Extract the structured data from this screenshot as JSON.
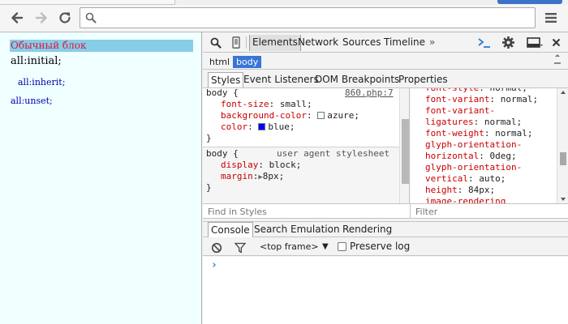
{
  "browser": {
    "address_value": "",
    "menu_icon": "hamburger-menu-icon"
  },
  "page": {
    "normal_block": "Обычный блок",
    "all_initial": "all:initial;",
    "all_inherit": "all:inherit;",
    "all_unset": "all:unset;"
  },
  "devtools": {
    "tabs": [
      "Elements",
      "Network",
      "Sources",
      "Timeline"
    ],
    "more_tabs": "»",
    "breadcrumb": [
      "html",
      "body"
    ],
    "subtabs": [
      "Styles",
      "Event Listeners",
      "DOM Breakpoints",
      "Properties"
    ],
    "rule1": {
      "selector": "body {",
      "source": "860.php:7",
      "props": [
        {
          "name": "font-size",
          "value": "small;"
        },
        {
          "name": "background-color",
          "value": "azure;",
          "swatch": "#f0ffff"
        },
        {
          "name": "color",
          "value": "blue;",
          "swatch": "#0000ff"
        }
      ],
      "close": "}"
    },
    "rule2": {
      "selector": "body {",
      "source": "user agent stylesheet",
      "props": [
        {
          "name": "display",
          "value": "block;"
        },
        {
          "name": "margin",
          "value": "8px;"
        }
      ],
      "close": "}"
    },
    "computed_lines": [
      {
        "name": "font-style",
        "value": "normal;"
      },
      {
        "name": "font-variant",
        "value": "normal;"
      },
      {
        "name": "font-variant-",
        "value": ""
      },
      {
        "name": "ligatures",
        "value": "normal;"
      },
      {
        "name": "font-weight",
        "value": "normal;"
      },
      {
        "name": "glyph-orientation-",
        "value": ""
      },
      {
        "name": "horizontal",
        "value": "0deg;"
      },
      {
        "name": "glyph-orientation-",
        "value": ""
      },
      {
        "name": "vertical",
        "value": "auto;"
      },
      {
        "name": "height",
        "value": "84px;"
      },
      {
        "name": "image-rendering",
        "value": ""
      }
    ],
    "find_placeholder": "Find in Styles",
    "filter_placeholder": "Filter",
    "drawer_tabs": [
      "Console",
      "Search",
      "Emulation",
      "Rendering"
    ],
    "frame_select": "<top frame>",
    "preserve_log": "Preserve log",
    "prompt": "›"
  },
  "colors": {
    "page_bg": "#f0ffff",
    "highlight_block": "#87cde8",
    "crumb_selected": "#3875d7",
    "prop_name": "#c80000"
  }
}
